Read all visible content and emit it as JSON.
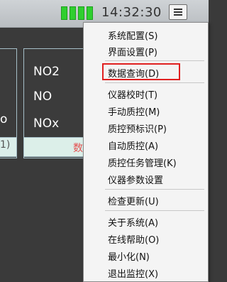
{
  "status": {
    "battery_bars": 4,
    "battery_color": "#2fcf2f",
    "time": "14:32:30"
  },
  "left_card": {
    "value_text": "o",
    "paren_text": "1)"
  },
  "gas_card": {
    "gases": [
      "NO2",
      "NO",
      "NOx"
    ],
    "footer_text": "数"
  },
  "menu": {
    "group1": [
      "系统配置(S)",
      "界面设置(P)"
    ],
    "group2": [
      "数据查询(D)"
    ],
    "group3": [
      "仪器校时(T)",
      "手动质控(M)",
      "质控预标识(P)",
      "自动质控(A)",
      "质控任务管理(K)",
      "仪器参数设置"
    ],
    "group4": [
      "检查更新(U)"
    ],
    "group5": [
      "关于系统(A)",
      "在线帮助(O)",
      "最小化(N)",
      "退出监控(X)"
    ],
    "highlight_color": "#e02020"
  }
}
